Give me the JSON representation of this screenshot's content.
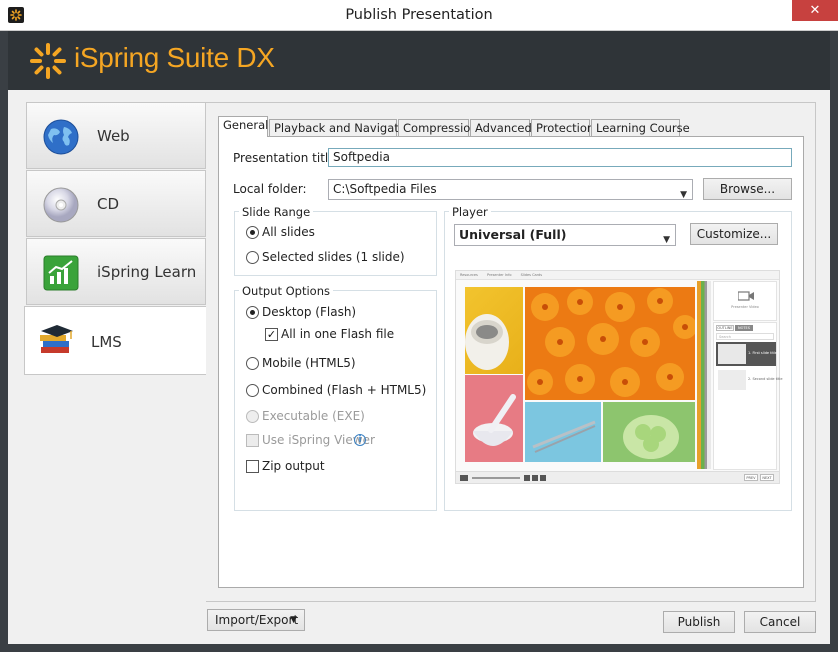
{
  "window": {
    "title": "Publish Presentation",
    "close_glyph": "✕"
  },
  "brand": {
    "name": "iSpring Suite DX",
    "accent": "#f5a623"
  },
  "sidebar": {
    "items": [
      {
        "label": "Web",
        "icon": "globe-icon"
      },
      {
        "label": "CD",
        "icon": "cd-icon"
      },
      {
        "label": "iSpring Learn",
        "icon": "chart-icon"
      },
      {
        "label": "LMS",
        "icon": "graduation-books-icon"
      }
    ]
  },
  "tabs": [
    "General",
    "Playback and Navigation",
    "Compression",
    "Advanced",
    "Protection",
    "Learning Course"
  ],
  "general": {
    "title_label": "Presentation title:",
    "title_value": "Softpedia",
    "folder_label": "Local folder:",
    "folder_value": "C:\\Softpedia Files",
    "browse": "Browse..."
  },
  "slide_range": {
    "title": "Slide Range",
    "all": "All slides",
    "selected": "Selected slides (1 slide)"
  },
  "output": {
    "title": "Output Options",
    "desktop": "Desktop (Flash)",
    "all_in_one": "All in one Flash file",
    "mobile": "Mobile (HTML5)",
    "combined": "Combined (Flash + HTML5)",
    "executable": "Executable (EXE)",
    "viewer": "Use iSpring Viewer",
    "zip": "Zip output"
  },
  "player": {
    "title": "Player",
    "selected": "Universal (Full)",
    "customize": "Customize...",
    "preview": {
      "tabs": [
        "Resources",
        "Presenter Info",
        "Slides Cards"
      ],
      "presenter_video": "Presenter Video",
      "outline_tab": "OUTLINE",
      "notes_tab": "NOTES",
      "search": "Search",
      "thumbs": [
        "1. First slide title",
        "2. Second slide title"
      ],
      "prev": "PREV",
      "next": "NEXT"
    }
  },
  "footer": {
    "import_export": "Import/Export",
    "publish": "Publish",
    "cancel": "Cancel"
  }
}
